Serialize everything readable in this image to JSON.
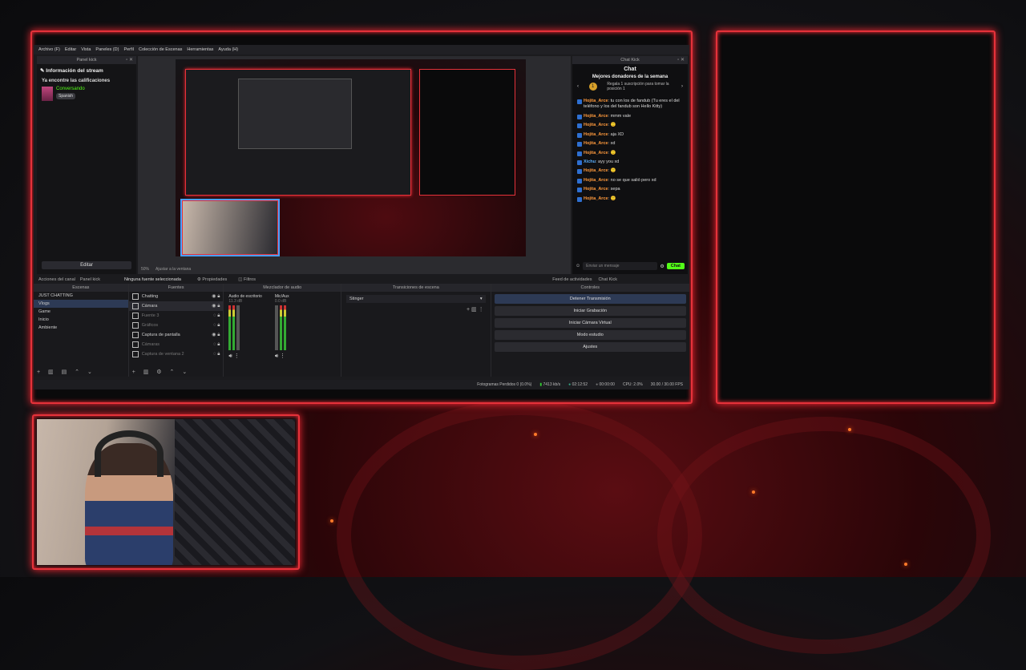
{
  "colors": {
    "accent_frame": "#e5323a",
    "kick_green": "#53fc18",
    "username": "#ff9a3d"
  },
  "menubar": {
    "items": [
      "Archivo (F)",
      "Editar",
      "Vista",
      "Paneles (D)",
      "Perfil",
      "Colección de Escenas",
      "Herramientas",
      "Ayuda (H)"
    ]
  },
  "panel_left": {
    "title": "Panel kick",
    "heading": "Información del stream",
    "rating": "Ya encontre las calificaciones",
    "category": "Conversando",
    "tag": "Spanish",
    "edit_label": "Editar",
    "tabs": [
      "Acciones del canal",
      "Panel kick"
    ]
  },
  "preview": {
    "zoom": "50%",
    "fit": "Ajustar a la ventana",
    "selection": "Ninguna fuente seleccionada",
    "properties": "Propiedades",
    "filters": "Filtros"
  },
  "chat": {
    "window_title": "Chat Kick",
    "title": "Chat",
    "donors_title": "Mejores donadores de la semana",
    "donor_badge": "1",
    "donor_text": "Regala 1 suscripción para tomar la posición 1",
    "messages": [
      {
        "user": "Hojita_Arce",
        "text": "tu con los de fandub (Tu eres el del teléfono y los del fandub son Hello Kitty)"
      },
      {
        "user": "Hojita_Arce",
        "text": "mmm vale"
      },
      {
        "user": "Hojita_Arce",
        "text": "🙂"
      },
      {
        "user": "Hojita_Arce",
        "text": "aja XD"
      },
      {
        "user": "Hojita_Arce",
        "text": "xd"
      },
      {
        "user": "Hojita_Arce",
        "text": "🙂"
      },
      {
        "user": "Xichu",
        "text": "ayy you xd"
      },
      {
        "user": "Hojita_Arce",
        "text": "🙂"
      },
      {
        "user": "Hojita_Arce",
        "text": "no se que salió pero xd"
      },
      {
        "user": "Hojita_Arce",
        "text": "sepa"
      },
      {
        "user": "Hojita_Arce",
        "text": "🙂"
      }
    ],
    "input_placeholder": "Enviar un mensaje",
    "send_label": "Chat",
    "tabs": [
      "Feed de actividades",
      "Chat Kick"
    ]
  },
  "docks": {
    "scenes": {
      "title": "Escenas",
      "items": [
        "JUST CHATTING",
        "Vlogs",
        "Game",
        "Inicio",
        "Ambiente"
      ],
      "selected": 1
    },
    "sources": {
      "title": "Fuentes",
      "items": [
        "Chatting",
        "Cámara",
        "Fuente 3",
        "Gráficos",
        "Captura de pantalla",
        "Cámaras",
        "Captura de ventana 2"
      ]
    },
    "mixer": {
      "title": "Mezclador de audio",
      "ch1": "Audio de escritorio",
      "ch1_db": "11.3 dB",
      "ch2": "Mic/Aux",
      "ch2_db": "0.0 dB"
    },
    "transitions": {
      "title": "Transiciones de escena",
      "value": "Stinger"
    },
    "controls": {
      "title": "Controles",
      "buttons": [
        "Detener Transmisión",
        "Iniciar Grabación",
        "Iniciar Cámara Virtual",
        "Modo estudio",
        "Ajustes"
      ]
    }
  },
  "status": {
    "dropped": "Fotogramas Perdidos 0 (0.0%)",
    "bitrate": "7413 kb/s",
    "live": "02:12:52",
    "rec": "00:00:00",
    "cpu": "CPU: 2.0%",
    "fps": "30.00 / 30.00 FPS"
  }
}
